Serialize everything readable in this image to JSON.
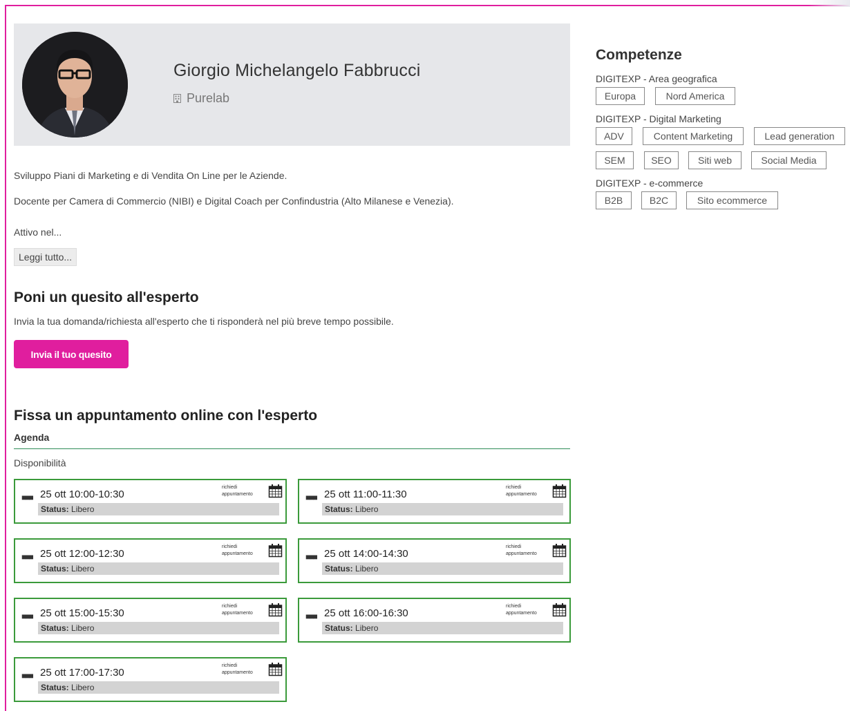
{
  "profile": {
    "name": "Giorgio Michelangelo Fabbrucci",
    "company": "Purelab"
  },
  "bio": {
    "line1": "Sviluppo Piani di Marketing e di Vendita On Line per le Aziende.",
    "line2": "Docente per Camera di Commercio (NIBI) e Digital Coach per Confindustria (Alto Milanese e Venezia).",
    "line3": "Attivo nel...",
    "read_more": "Leggi tutto..."
  },
  "question": {
    "title": "Poni un quesito all'esperto",
    "description": "Invia la tua domanda/richiesta all'esperto che ti risponderà nel più breve tempo possibile.",
    "button": "Invia il tuo quesito"
  },
  "appointment": {
    "title": "Fissa un appuntamento online con l'esperto",
    "agenda_label": "Agenda",
    "availability_label": "Disponibilità",
    "request_label": "richiedi appuntamento",
    "status_label": "Status:",
    "slots": [
      {
        "time": "25 ott 10:00-10:30",
        "status": "Libero"
      },
      {
        "time": "25 ott 11:00-11:30",
        "status": "Libero"
      },
      {
        "time": "25 ott 12:00-12:30",
        "status": "Libero"
      },
      {
        "time": "25 ott 14:00-14:30",
        "status": "Libero"
      },
      {
        "time": "25 ott 15:00-15:30",
        "status": "Libero"
      },
      {
        "time": "25 ott 16:00-16:30",
        "status": "Libero"
      },
      {
        "time": "25 ott 17:00-17:30",
        "status": "Libero"
      }
    ]
  },
  "skills": {
    "title": "Competenze",
    "categories": [
      {
        "label": "DIGITEXP - Area geografica",
        "tags": [
          "Europa",
          "Nord America"
        ]
      },
      {
        "label": "DIGITEXP - Digital Marketing",
        "tags": [
          "ADV",
          "Content Marketing",
          "Lead generation",
          "SEM",
          "SEO",
          "Siti web",
          "Social Media"
        ]
      },
      {
        "label": "DIGITEXP - e-commerce",
        "tags": [
          "B2B",
          "B2C",
          "Sito ecommerce"
        ]
      }
    ]
  },
  "colors": {
    "accent": "#e01e9e",
    "slot_border": "#3a9a3a",
    "agenda_rule": "#2e8b57"
  }
}
